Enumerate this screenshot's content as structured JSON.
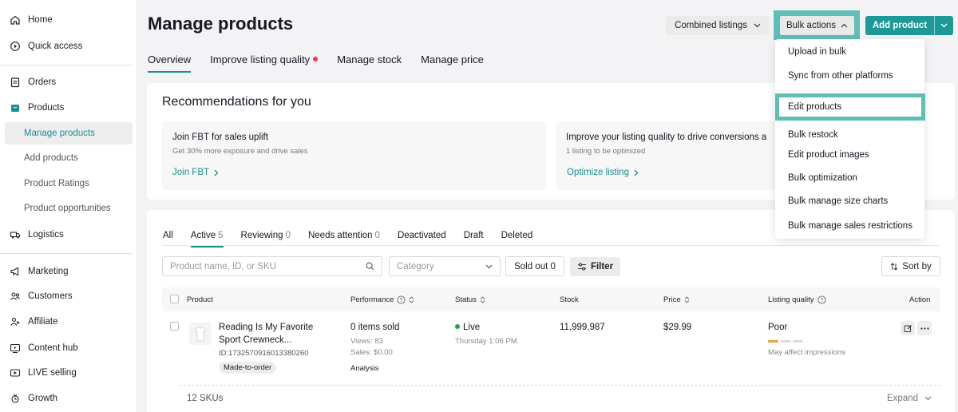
{
  "sidebar": {
    "items": [
      {
        "label": "Home",
        "icon": "home-icon"
      },
      {
        "label": "Quick access",
        "icon": "quick-access-icon"
      },
      {
        "label": "Orders",
        "icon": "orders-icon"
      },
      {
        "label": "Products",
        "icon": "products-icon"
      },
      {
        "label": "Manage products",
        "active": true
      },
      {
        "label": "Add products"
      },
      {
        "label": "Product Ratings"
      },
      {
        "label": "Product opportunities"
      },
      {
        "label": "Logistics",
        "icon": "truck-icon"
      },
      {
        "label": "Marketing",
        "icon": "megaphone-icon"
      },
      {
        "label": "Customers",
        "icon": "customers-icon"
      },
      {
        "label": "Affiliate",
        "icon": "affiliate-icon"
      },
      {
        "label": "Content hub",
        "icon": "content-icon"
      },
      {
        "label": "LIVE selling",
        "icon": "live-icon"
      },
      {
        "label": "Growth",
        "icon": "growth-icon"
      }
    ]
  },
  "header": {
    "title": "Manage products",
    "combined_listings": "Combined listings",
    "bulk_actions": "Bulk actions",
    "add_product": "Add product"
  },
  "tabs": [
    {
      "label": "Overview",
      "active": true
    },
    {
      "label": "Improve listing quality",
      "dot": true
    },
    {
      "label": "Manage stock"
    },
    {
      "label": "Manage price"
    }
  ],
  "recommendations": {
    "title": "Recommendations for you",
    "cards": [
      {
        "title": "Join FBT for sales uplift",
        "subtitle": "Get 30% more exposure and drive sales",
        "link": "Join FBT"
      },
      {
        "title": "Improve your listing quality to drive conversions a",
        "subtitle": "1 listing to be optimized",
        "link": "Optimize listing"
      }
    ]
  },
  "bulk_menu": {
    "items": [
      "Upload in bulk",
      "Sync from other platforms",
      "Edit products",
      "Bulk restock",
      "Edit product images",
      "Bulk optimization",
      "Bulk manage size charts",
      "Bulk manage sales restrictions"
    ],
    "highlighted": "Edit products"
  },
  "status_tabs": [
    {
      "label": "All",
      "count": ""
    },
    {
      "label": "Active",
      "count": "5",
      "active": true
    },
    {
      "label": "Reviewing",
      "count": "0"
    },
    {
      "label": "Needs attention",
      "count": "0"
    },
    {
      "label": "Deactivated",
      "count": ""
    },
    {
      "label": "Draft",
      "count": ""
    },
    {
      "label": "Deleted",
      "count": ""
    }
  ],
  "filters": {
    "search_placeholder": "Product name, ID, or SKU",
    "category_placeholder": "Category",
    "sold_out": "Sold out 0",
    "filter": "Filter",
    "sort_by": "Sort by"
  },
  "table": {
    "columns": [
      "Product",
      "Performance",
      "Status",
      "Stock",
      "Price",
      "Listing quality",
      "Action"
    ],
    "rows": [
      {
        "name_line1": "Reading Is My Favorite",
        "name_line2": "Sport Crewneck...",
        "id": "ID:1732570916013380260",
        "tag": "Made-to-order",
        "items_sold": "0 items sold",
        "views": "Views: 83",
        "sales": "Sales: $0.00",
        "analysis": "Analysis",
        "status": "Live",
        "status_time": "Thursday 1:06 PM",
        "stock": "11,999,987",
        "price": "$29.99",
        "quality": "Poor",
        "quality_level": 1,
        "quality_note": "May affect impressions"
      }
    ],
    "skus": "12 SKUs",
    "expand": "Expand"
  },
  "colors": {
    "accent": "#1d9a98",
    "highlight": "#5ebfb6",
    "quality_poor": "#e8a33d",
    "live": "#20a04a"
  }
}
